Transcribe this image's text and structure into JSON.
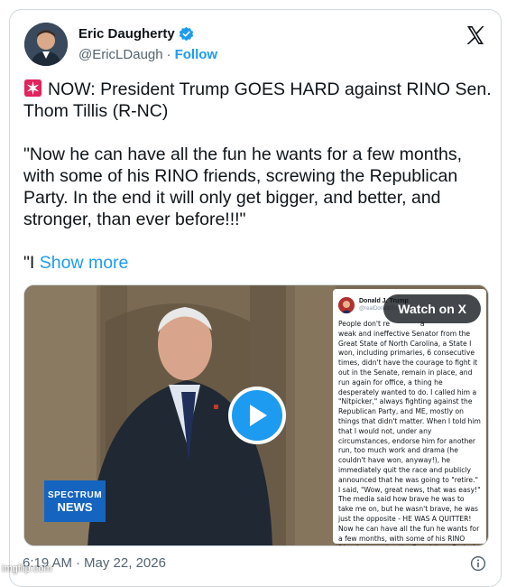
{
  "author": {
    "display_name": "Eric Daugherty",
    "handle": "@EricLDaugh",
    "separator": "·",
    "follow_label": "Follow"
  },
  "tweet": {
    "text": "NOW: President Trump GOES HARD against RINO Sen. Thom Tillis (R-NC)\n\n\"Now he can have all the fun he wants for a few months, with some of his RINO friends, screwing the Republican Party. In the end it will only get bigger, and better, and stronger, than ever before!!!\"\n\n\"I ",
    "show_more_label": "Show more"
  },
  "media": {
    "watch_label": "Watch on X",
    "news_logo_line1": "SPECTRUM",
    "news_logo_line2": "NEWS",
    "embedded_post": {
      "author": "Donald J. Trump",
      "handle": "@realDonaldTrump",
      "body": "People don't re              a\nweak and ineffective Senator from the Great State of North Carolina, a State I won, including primaries, 6 consecutive times, didn't have the courage to fight it out in the Senate, remain in place, and run again for office, a thing he desperately wanted to do. I called him a \"Nitpicker,\" always fighting against the Republican Party, and ME, mostly on things that didn't matter. When I told him that I would not, under any circumstances, endorse him for another run, too much work and drama (he couldn't have won, anyway!), he immediately quit the race and publicly announced that he was going to \"retire.\" I said, \"Wow, great news, that was easy!\" The media said how brave he was to take me on, but he wasn't brave, he was just the opposite - HE WAS A QUITTER! Now he can have all the fun he wants for a few months, with some of his RINO friends, screwing the Republican Party. In the end it will only get bigger, and better, and stronger, than ever before!!! President DJT"
    }
  },
  "footer": {
    "time": "6:19 AM",
    "separator": "·",
    "date": "May 22, 2026"
  },
  "watermark": "imgflip.com",
  "colors": {
    "accent": "#1d9bf0",
    "text": "#0f1419",
    "muted": "#536471",
    "border": "#cfd9de"
  },
  "icons": [
    "verified-badge-icon",
    "x-logo-icon",
    "siren-icon",
    "play-icon",
    "info-icon"
  ]
}
